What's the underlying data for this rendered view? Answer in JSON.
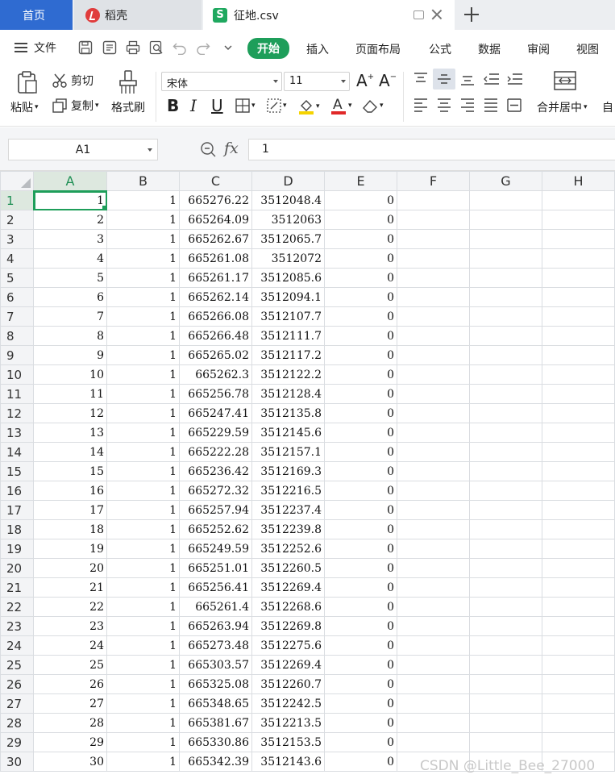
{
  "tabs": {
    "home": "首页",
    "docer": "稻壳",
    "file": "征地.csv"
  },
  "menu": {
    "file_label": "文件",
    "items": [
      "开始",
      "插入",
      "页面布局",
      "公式",
      "数据",
      "审阅",
      "视图"
    ],
    "active": "开始"
  },
  "ribbon": {
    "paste": "粘贴",
    "cut": "剪切",
    "copy": "复制",
    "format_painter": "格式刷",
    "font_name": "宋体",
    "font_size": "11",
    "merge_center": "合并居中",
    "auto": "自"
  },
  "formula_bar": {
    "name_box": "A1",
    "fx": "fx",
    "value": "1"
  },
  "columns": [
    "A",
    "B",
    "C",
    "D",
    "E",
    "F",
    "G",
    "H"
  ],
  "rows": [
    {
      "n": "1",
      "A": "1",
      "B": "1",
      "C": "665276.22",
      "D": "3512048.4",
      "E": "0"
    },
    {
      "n": "2",
      "A": "2",
      "B": "1",
      "C": "665264.09",
      "D": "3512063",
      "E": "0"
    },
    {
      "n": "3",
      "A": "3",
      "B": "1",
      "C": "665262.67",
      "D": "3512065.7",
      "E": "0"
    },
    {
      "n": "4",
      "A": "4",
      "B": "1",
      "C": "665261.08",
      "D": "3512072",
      "E": "0"
    },
    {
      "n": "5",
      "A": "5",
      "B": "1",
      "C": "665261.17",
      "D": "3512085.6",
      "E": "0"
    },
    {
      "n": "6",
      "A": "6",
      "B": "1",
      "C": "665262.14",
      "D": "3512094.1",
      "E": "0"
    },
    {
      "n": "7",
      "A": "7",
      "B": "1",
      "C": "665266.08",
      "D": "3512107.7",
      "E": "0"
    },
    {
      "n": "8",
      "A": "8",
      "B": "1",
      "C": "665266.48",
      "D": "3512111.7",
      "E": "0"
    },
    {
      "n": "9",
      "A": "9",
      "B": "1",
      "C": "665265.02",
      "D": "3512117.2",
      "E": "0"
    },
    {
      "n": "10",
      "A": "10",
      "B": "1",
      "C": "665262.3",
      "D": "3512122.2",
      "E": "0"
    },
    {
      "n": "11",
      "A": "11",
      "B": "1",
      "C": "665256.78",
      "D": "3512128.4",
      "E": "0"
    },
    {
      "n": "12",
      "A": "12",
      "B": "1",
      "C": "665247.41",
      "D": "3512135.8",
      "E": "0"
    },
    {
      "n": "13",
      "A": "13",
      "B": "1",
      "C": "665229.59",
      "D": "3512145.6",
      "E": "0"
    },
    {
      "n": "14",
      "A": "14",
      "B": "1",
      "C": "665222.28",
      "D": "3512157.1",
      "E": "0"
    },
    {
      "n": "15",
      "A": "15",
      "B": "1",
      "C": "665236.42",
      "D": "3512169.3",
      "E": "0"
    },
    {
      "n": "16",
      "A": "16",
      "B": "1",
      "C": "665272.32",
      "D": "3512216.5",
      "E": "0"
    },
    {
      "n": "17",
      "A": "17",
      "B": "1",
      "C": "665257.94",
      "D": "3512237.4",
      "E": "0"
    },
    {
      "n": "18",
      "A": "18",
      "B": "1",
      "C": "665252.62",
      "D": "3512239.8",
      "E": "0"
    },
    {
      "n": "19",
      "A": "19",
      "B": "1",
      "C": "665249.59",
      "D": "3512252.6",
      "E": "0"
    },
    {
      "n": "20",
      "A": "20",
      "B": "1",
      "C": "665251.01",
      "D": "3512260.5",
      "E": "0"
    },
    {
      "n": "21",
      "A": "21",
      "B": "1",
      "C": "665256.41",
      "D": "3512269.4",
      "E": "0"
    },
    {
      "n": "22",
      "A": "22",
      "B": "1",
      "C": "665261.4",
      "D": "3512268.6",
      "E": "0"
    },
    {
      "n": "23",
      "A": "23",
      "B": "1",
      "C": "665263.94",
      "D": "3512269.8",
      "E": "0"
    },
    {
      "n": "24",
      "A": "24",
      "B": "1",
      "C": "665273.48",
      "D": "3512275.6",
      "E": "0"
    },
    {
      "n": "25",
      "A": "25",
      "B": "1",
      "C": "665303.57",
      "D": "3512269.4",
      "E": "0"
    },
    {
      "n": "26",
      "A": "26",
      "B": "1",
      "C": "665325.08",
      "D": "3512260.7",
      "E": "0"
    },
    {
      "n": "27",
      "A": "27",
      "B": "1",
      "C": "665348.65",
      "D": "3512242.5",
      "E": "0"
    },
    {
      "n": "28",
      "A": "28",
      "B": "1",
      "C": "665381.67",
      "D": "3512213.5",
      "E": "0"
    },
    {
      "n": "29",
      "A": "29",
      "B": "1",
      "C": "665330.86",
      "D": "3512153.5",
      "E": "0"
    },
    {
      "n": "30",
      "A": "30",
      "B": "1",
      "C": "665342.39",
      "D": "3512143.6",
      "E": "0"
    }
  ],
  "selected_cell": "A1",
  "watermark": "CSDN @Little_Bee_27000",
  "colors": {
    "accent": "#1e9e5a",
    "home_tab": "#2f6bd1"
  }
}
